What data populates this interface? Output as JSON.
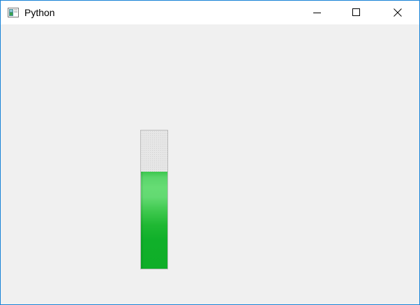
{
  "window": {
    "title": "Python",
    "icon": "python-app-icon",
    "controls": {
      "minimize_icon": "minimize-icon",
      "maximize_icon": "maximize-icon",
      "close_icon": "close-icon"
    },
    "border_color": "#1883d7"
  },
  "progress_bar": {
    "orientation": "vertical",
    "value_fraction": 0.7,
    "fill_color": "#06b025",
    "track_color": "#e6e6e6"
  }
}
